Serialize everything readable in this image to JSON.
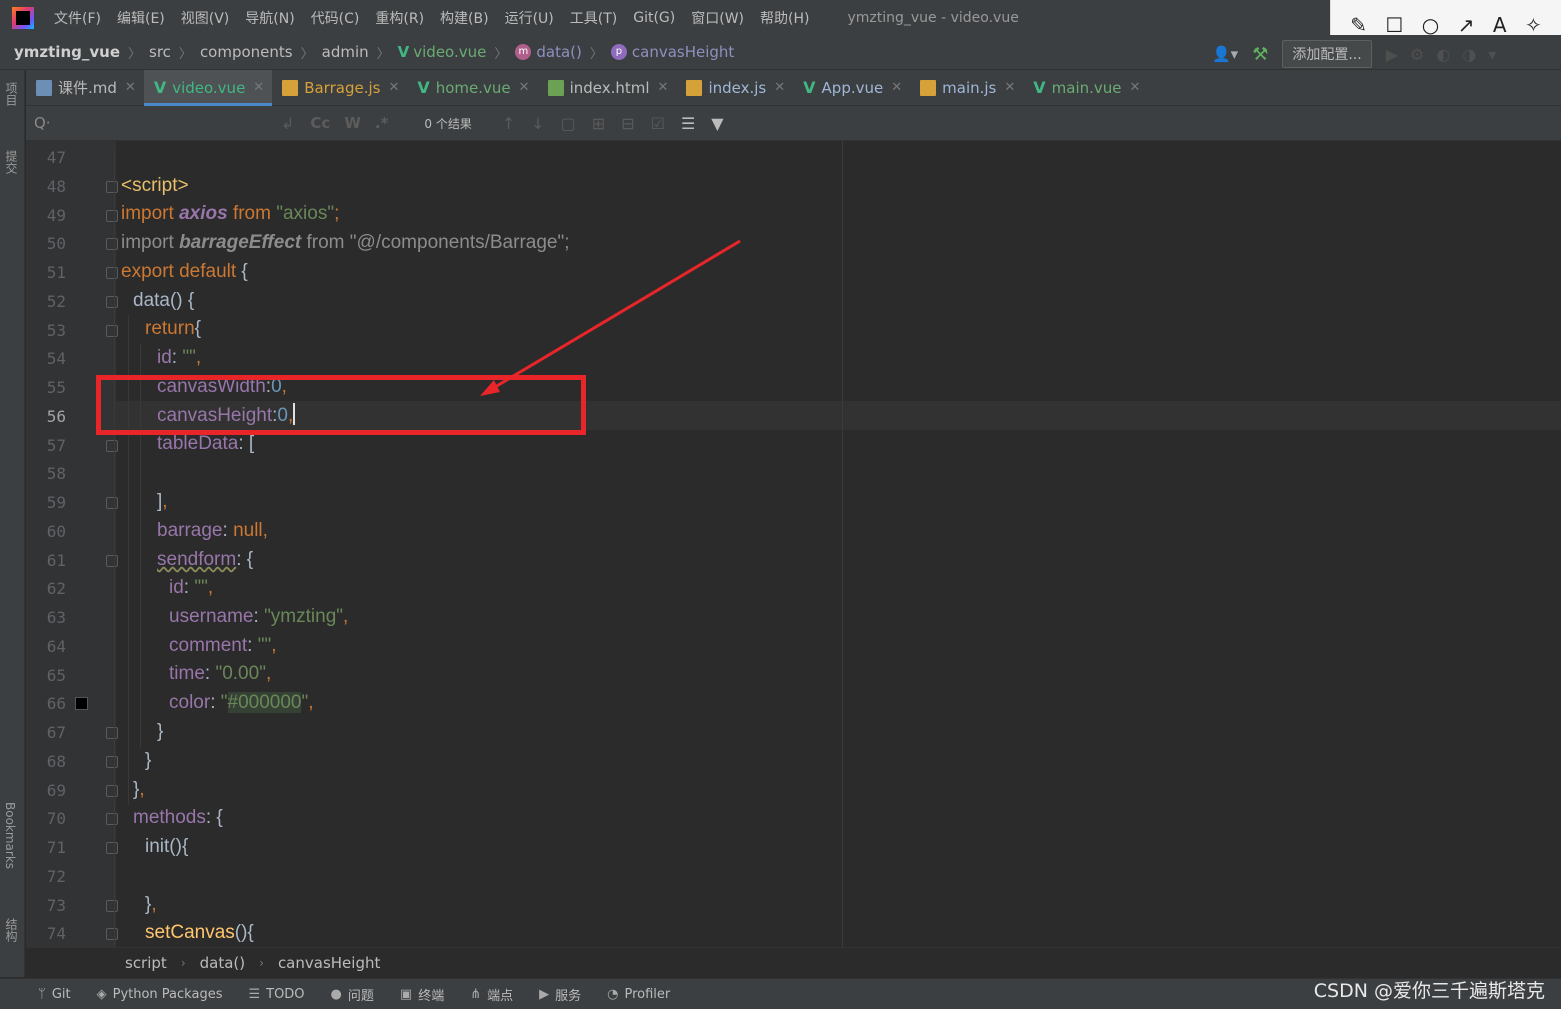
{
  "menubar": {
    "items": [
      "文件(F)",
      "编辑(E)",
      "视图(V)",
      "导航(N)",
      "代码(C)",
      "重构(R)",
      "构建(B)",
      "运行(U)",
      "工具(T)",
      "Git(G)",
      "窗口(W)",
      "帮助(H)"
    ],
    "window_title": "ymzting_vue - video.vue"
  },
  "annotation_toolbar": {
    "pencil_glyph": "✎",
    "rect_glyph": "☐",
    "circle_glyph": "○",
    "arrow_glyph": "↗",
    "text_glyph": "A",
    "magic_glyph": "✧"
  },
  "navbar": {
    "project": "ymzting_vue",
    "crumbs": [
      "src",
      "components",
      "admin"
    ],
    "file": "video.vue",
    "method_badge": "m",
    "method": "data()",
    "prop_badge": "p",
    "prop": "canvasHeight",
    "config_button": "添加配置..."
  },
  "left_strip": {
    "project": "项目",
    "commit": "提交",
    "bookmarks": "Bookmarks",
    "structure": "结构"
  },
  "tabs": [
    {
      "label": "课件.md",
      "kind": "md"
    },
    {
      "label": "video.vue",
      "kind": "vue"
    },
    {
      "label": "Barrage.js",
      "kind": "js"
    },
    {
      "label": "home.vue",
      "kind": "vue"
    },
    {
      "label": "index.html",
      "kind": "html"
    },
    {
      "label": "index.js",
      "kind": "js"
    },
    {
      "label": "App.vue",
      "kind": "vue"
    },
    {
      "label": "main.js",
      "kind": "js"
    },
    {
      "label": "main.vue",
      "kind": "vue"
    }
  ],
  "findbar": {
    "search_glyph": "Q·",
    "opt_case": "Cc",
    "opt_word": "W",
    "opt_regex": ".*",
    "result_text": "0 个结果"
  },
  "editor": {
    "line_numbers": [
      "47",
      "48",
      "49",
      "50",
      "51",
      "52",
      "53",
      "54",
      "55",
      "56",
      "57",
      "58",
      "59",
      "60",
      "61",
      "62",
      "63",
      "64",
      "65",
      "66",
      "67",
      "68",
      "69",
      "70",
      "71",
      "72",
      "73",
      "74"
    ],
    "current_line": "56"
  },
  "breadcrumb_bottom": [
    "script",
    "data()",
    "canvasHeight"
  ],
  "statusbar": {
    "items": [
      "Git",
      "Python Packages",
      "TODO",
      "问题",
      "终端",
      "端点",
      "服务",
      "Profiler"
    ],
    "watermark": "CSDN @爱你三千遍斯塔克"
  },
  "colors": {
    "annotation_red": "#e8262a",
    "vue_green": "#41b883",
    "keyword": "#cc7832",
    "string": "#6a8759",
    "property": "#9876aa"
  }
}
